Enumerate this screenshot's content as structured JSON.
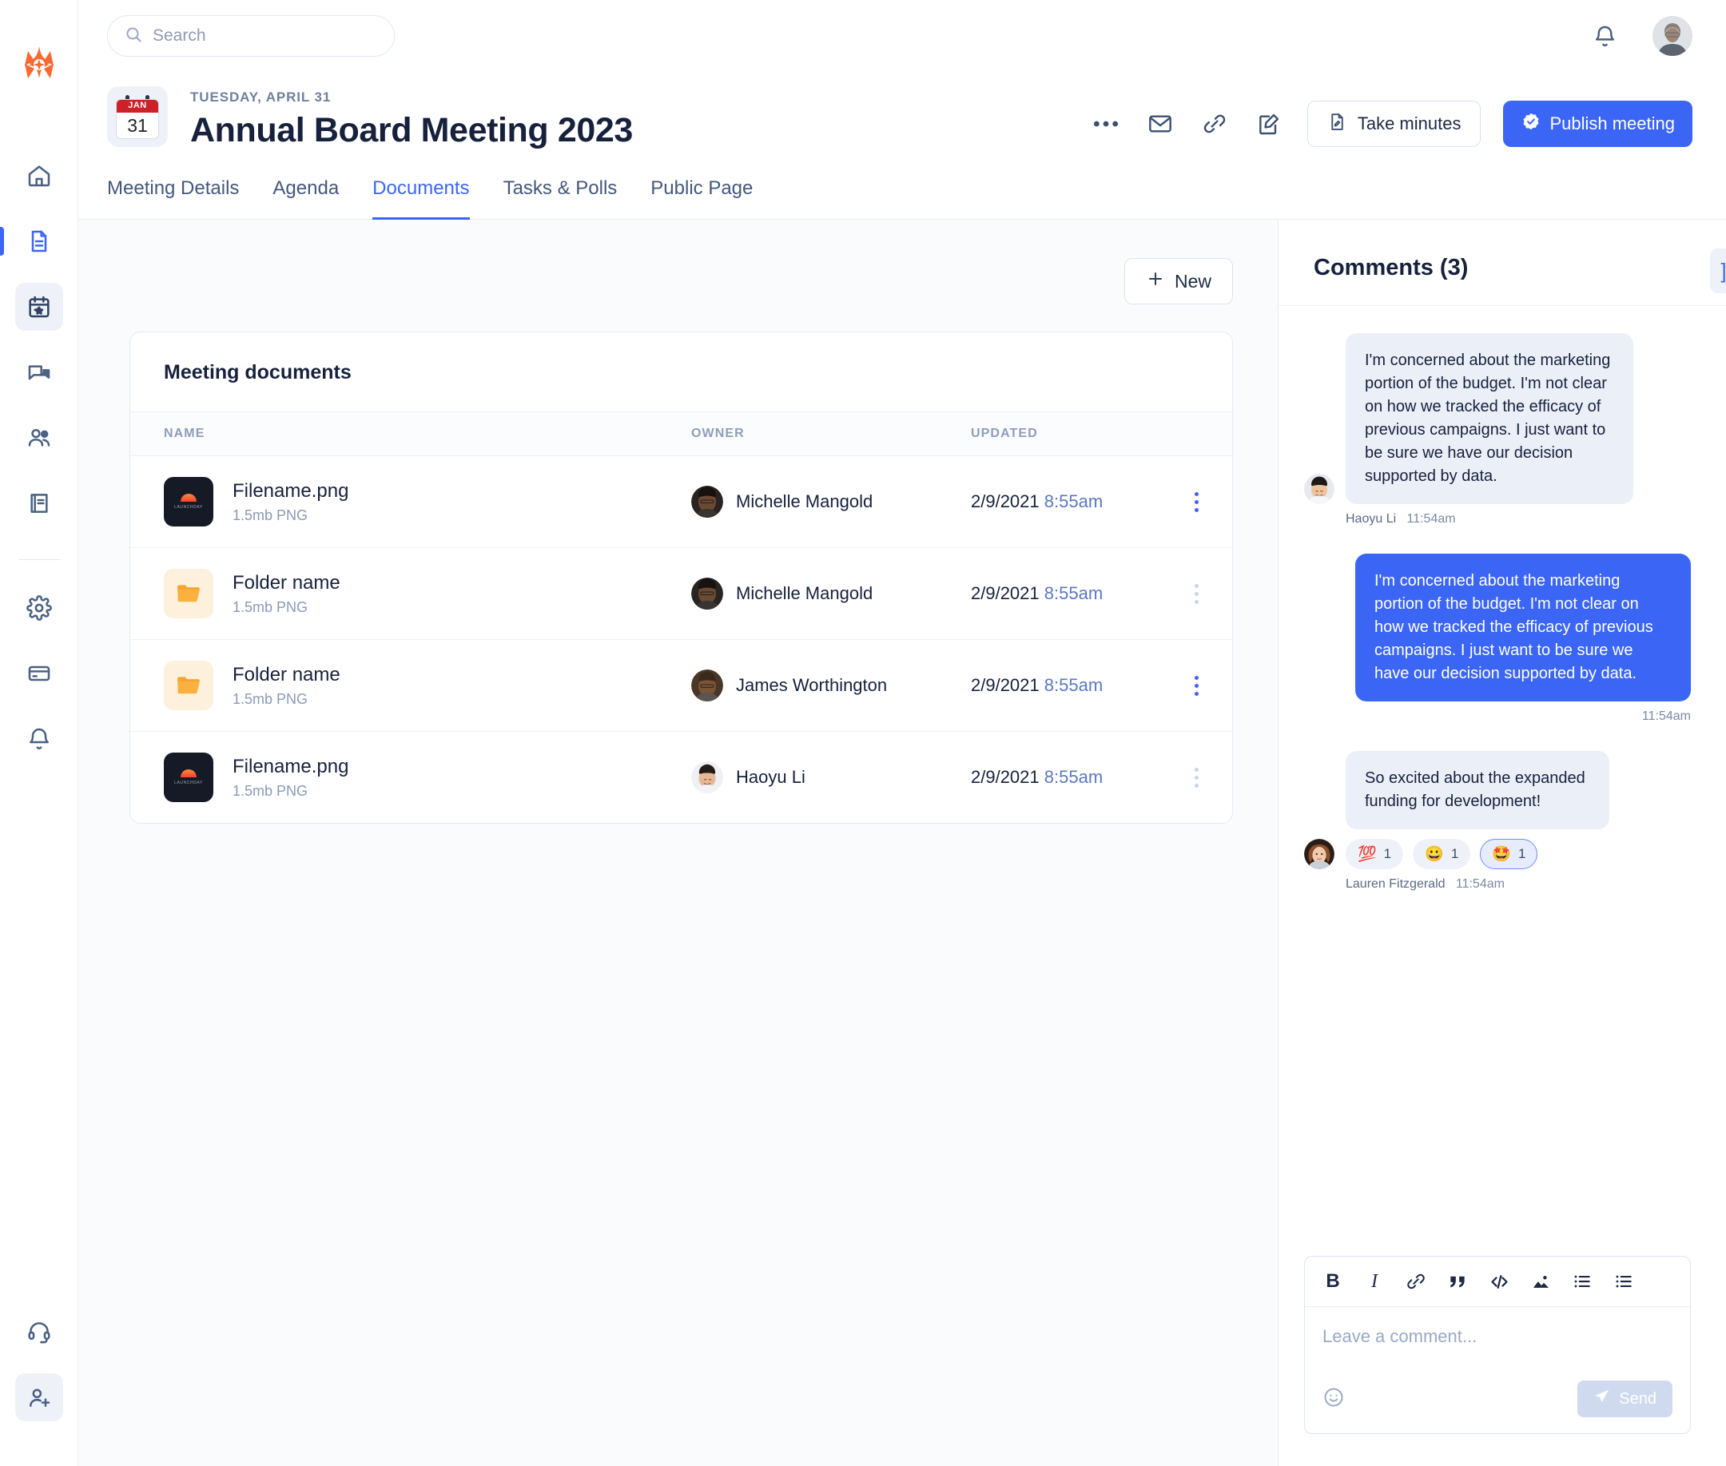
{
  "brand": {
    "accent": "#3b66f5",
    "logo_color": "#fa6831",
    "logo_name": "app-logo"
  },
  "rail": {
    "items": [
      {
        "icon": "home-icon",
        "label": "Home",
        "active": false
      },
      {
        "icon": "document-icon",
        "label": "Documents",
        "active": false,
        "marker": true
      },
      {
        "icon": "calendar-star-icon",
        "label": "Meetings",
        "active": true
      },
      {
        "icon": "chat-icon",
        "label": "Messages",
        "active": false
      },
      {
        "icon": "people-icon",
        "label": "People",
        "active": false
      },
      {
        "icon": "book-icon",
        "label": "Library",
        "active": false
      },
      {
        "icon": "gear-icon",
        "label": "Settings",
        "active": false
      },
      {
        "icon": "credit-card-icon",
        "label": "Billing",
        "active": false
      },
      {
        "icon": "bell-icon",
        "label": "Notifications",
        "active": false
      }
    ],
    "bottom": [
      {
        "icon": "headset-icon",
        "label": "Support",
        "active": false
      },
      {
        "icon": "add-user-icon",
        "label": "Invite",
        "active": true
      }
    ]
  },
  "search": {
    "placeholder": "Search",
    "value": "",
    "icon": "search-icon"
  },
  "topbar": {
    "bell": "bell-icon",
    "avatar": "user-avatar"
  },
  "meeting": {
    "date_label": "TUESDAY, APRIL 31",
    "title": "Annual Board Meeting 2023",
    "calendar_month": "JAN",
    "calendar_day": "31",
    "actions": {
      "more": "more-horizontal-icon",
      "email": "envelope-icon",
      "link": "link-icon",
      "edit": "edit-icon",
      "take_minutes_label": "Take minutes",
      "take_minutes_icon": "minutes-icon",
      "publish_label": "Publish meeting",
      "publish_icon": "seal-check-icon"
    }
  },
  "tabs": [
    {
      "label": "Meeting Details",
      "selected": false
    },
    {
      "label": "Agenda",
      "selected": false
    },
    {
      "label": "Documents",
      "selected": true
    },
    {
      "label": "Tasks & Polls",
      "selected": false
    },
    {
      "label": "Public Page",
      "selected": false
    }
  ],
  "documents": {
    "new_button": "New",
    "new_icon": "plus-icon",
    "card_title": "Meeting documents",
    "columns": [
      "NAME",
      "OWNER",
      "UPDATED"
    ],
    "rows": [
      {
        "name": "Filename.png",
        "meta": "1.5mb PNG",
        "kind": "file",
        "thumb_watermark": "LAUNCHDAY",
        "owner": "Michelle Mangold",
        "updated_date": "2/9/2021",
        "updated_time": "8:55am",
        "menu_active": true
      },
      {
        "name": "Folder name",
        "meta": "1.5mb PNG",
        "kind": "folder",
        "thumb_watermark": "",
        "owner": "Michelle Mangold",
        "updated_date": "2/9/2021",
        "updated_time": "8:55am",
        "menu_active": false
      },
      {
        "name": "Folder name",
        "meta": "1.5mb PNG",
        "kind": "folder",
        "thumb_watermark": "",
        "owner": "James Worthington",
        "updated_date": "2/9/2021",
        "updated_time": "8:55am",
        "menu_active": true
      },
      {
        "name": "Filename.png",
        "meta": "1.5mb PNG",
        "kind": "file",
        "thumb_watermark": "LAUNCHDAY",
        "owner": "Haoyu Li",
        "updated_date": "2/9/2021",
        "updated_time": "8:55am",
        "menu_active": false
      }
    ]
  },
  "comments": {
    "title": "Comments (3)",
    "collapse_icon": "collapse-panel-icon",
    "messages": [
      {
        "side": "left",
        "text": "I'm concerned about the marketing portion of the budget. I'm not clear on how we tracked the efficacy of previous campaigns. I just want to be sure we have our decision supported by data.",
        "author": "Haoyu Li",
        "time": "11:54am",
        "reactions": []
      },
      {
        "side": "right",
        "text": "I'm concerned about the marketing portion of the budget. I'm not clear on how we tracked the efficacy of previous campaigns. I just want to be sure we have our decision supported by data.",
        "author": "",
        "time": "11:54am",
        "reactions": []
      },
      {
        "side": "left",
        "text": "So excited about the expanded funding for development!",
        "author": "Lauren Fitzgerald",
        "time": "11:54am",
        "reactions": [
          {
            "emoji": "💯",
            "count": "1",
            "selected": false
          },
          {
            "emoji": "😀",
            "count": "1",
            "selected": false
          },
          {
            "emoji": "🤩",
            "count": "1",
            "selected": true
          }
        ]
      }
    ],
    "composer": {
      "toolbar": [
        {
          "icon": "bold-icon",
          "label": "B"
        },
        {
          "icon": "italic-icon",
          "label": "I"
        },
        {
          "icon": "link-icon",
          "label": ""
        },
        {
          "icon": "quote-icon",
          "label": ""
        },
        {
          "icon": "code-icon",
          "label": ""
        },
        {
          "icon": "image-icon",
          "label": ""
        },
        {
          "icon": "bullet-list-icon",
          "label": ""
        },
        {
          "icon": "ordered-list-icon",
          "label": ""
        }
      ],
      "placeholder": "Leave a comment...",
      "value": "",
      "emoji_icon": "emoji-icon",
      "send_label": "Send",
      "send_icon": "send-icon"
    }
  }
}
